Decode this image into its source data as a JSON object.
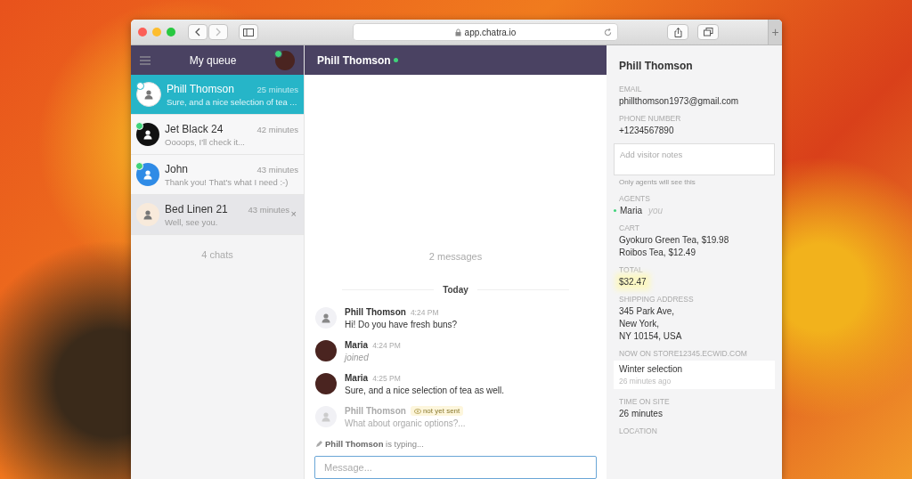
{
  "browser": {
    "url": "app.chatra.io",
    "new_tab": "+"
  },
  "sidebar": {
    "title": "My queue",
    "agent_online": true,
    "footer": "4 chats",
    "chats": [
      {
        "name": "Phill Thomson",
        "time": "25 minutes",
        "preview": "Sure, and a nice selection of tea ...",
        "avatar": {
          "kind": "light"
        },
        "online": true,
        "selected": true,
        "hovered": false
      },
      {
        "name": "Jet Black 24",
        "time": "42 minutes",
        "preview": "Oooops, I'll check it...",
        "avatar": {
          "kind": "black"
        },
        "online": true,
        "selected": false,
        "hovered": false
      },
      {
        "name": "John",
        "time": "43 minutes",
        "preview": "Thank you! That's what I need :-)",
        "avatar": {
          "kind": "blue"
        },
        "online": true,
        "selected": false,
        "hovered": false
      },
      {
        "name": "Bed Linen 21",
        "time": "43 minutes",
        "preview": "Well, see you.",
        "avatar": {
          "kind": "beige"
        },
        "online": false,
        "selected": false,
        "hovered": true,
        "close": "×"
      }
    ]
  },
  "chat": {
    "title": "Phill Thomson",
    "online": true,
    "count": "2 messages",
    "divider": "Today",
    "messages": [
      {
        "kind": "message",
        "author": "Phill Thomson",
        "avatar": {
          "kind": "visitor"
        },
        "time": "4:24 PM",
        "text": "Hi! Do you have fresh buns?"
      },
      {
        "kind": "event",
        "author": "Maria",
        "avatar": {
          "kind": "agent"
        },
        "time": "4:24 PM",
        "text": "joined"
      },
      {
        "kind": "message",
        "author": "Maria",
        "avatar": {
          "kind": "agent"
        },
        "time": "4:25 PM",
        "text": "Sure, and a nice selection of tea as well."
      },
      {
        "kind": "pending",
        "author": "Phill Thomson",
        "avatar": {
          "kind": "visitor"
        },
        "badge": "not yet sent",
        "text": "What about organic options?..."
      }
    ],
    "typing": "**Phill Thomson** is typing...",
    "input": {
      "placeholder": "Message..."
    }
  },
  "visitor": {
    "name": "Phill Thomson",
    "sections": [
      {
        "kind": "field",
        "label": "EMAIL",
        "lines": [
          "phillthomson1973@gmail.com"
        ]
      },
      {
        "kind": "field",
        "label": "PHONE NUMBER",
        "lines": [
          "+1234567890"
        ]
      },
      {
        "kind": "notes",
        "placeholder": "Add visitor notes",
        "hint": "Only agents will see this"
      },
      {
        "kind": "agents",
        "label": "AGENTS",
        "name": "Maria",
        "note": "you"
      },
      {
        "kind": "field",
        "label": "CART",
        "lines": [
          "Gyokuro Green Tea, $19.98",
          "Roibos Tea, $12.49"
        ]
      },
      {
        "kind": "highlight",
        "label": "TOTAL",
        "lines": [
          "$32.47"
        ]
      },
      {
        "kind": "field",
        "label": "SHIPPING ADDRESS",
        "lines": [
          "345 Park Ave,",
          "New York,",
          "NY 10154, USA"
        ]
      },
      {
        "kind": "page",
        "label": "NOW ON STORE12345.ECWID.COM",
        "title": "Winter selection",
        "time": "26 minutes ago"
      },
      {
        "kind": "field",
        "label": "TIME ON SITE",
        "lines": [
          "26 minutes"
        ]
      },
      {
        "kind": "field",
        "label": "LOCATION"
      }
    ]
  }
}
